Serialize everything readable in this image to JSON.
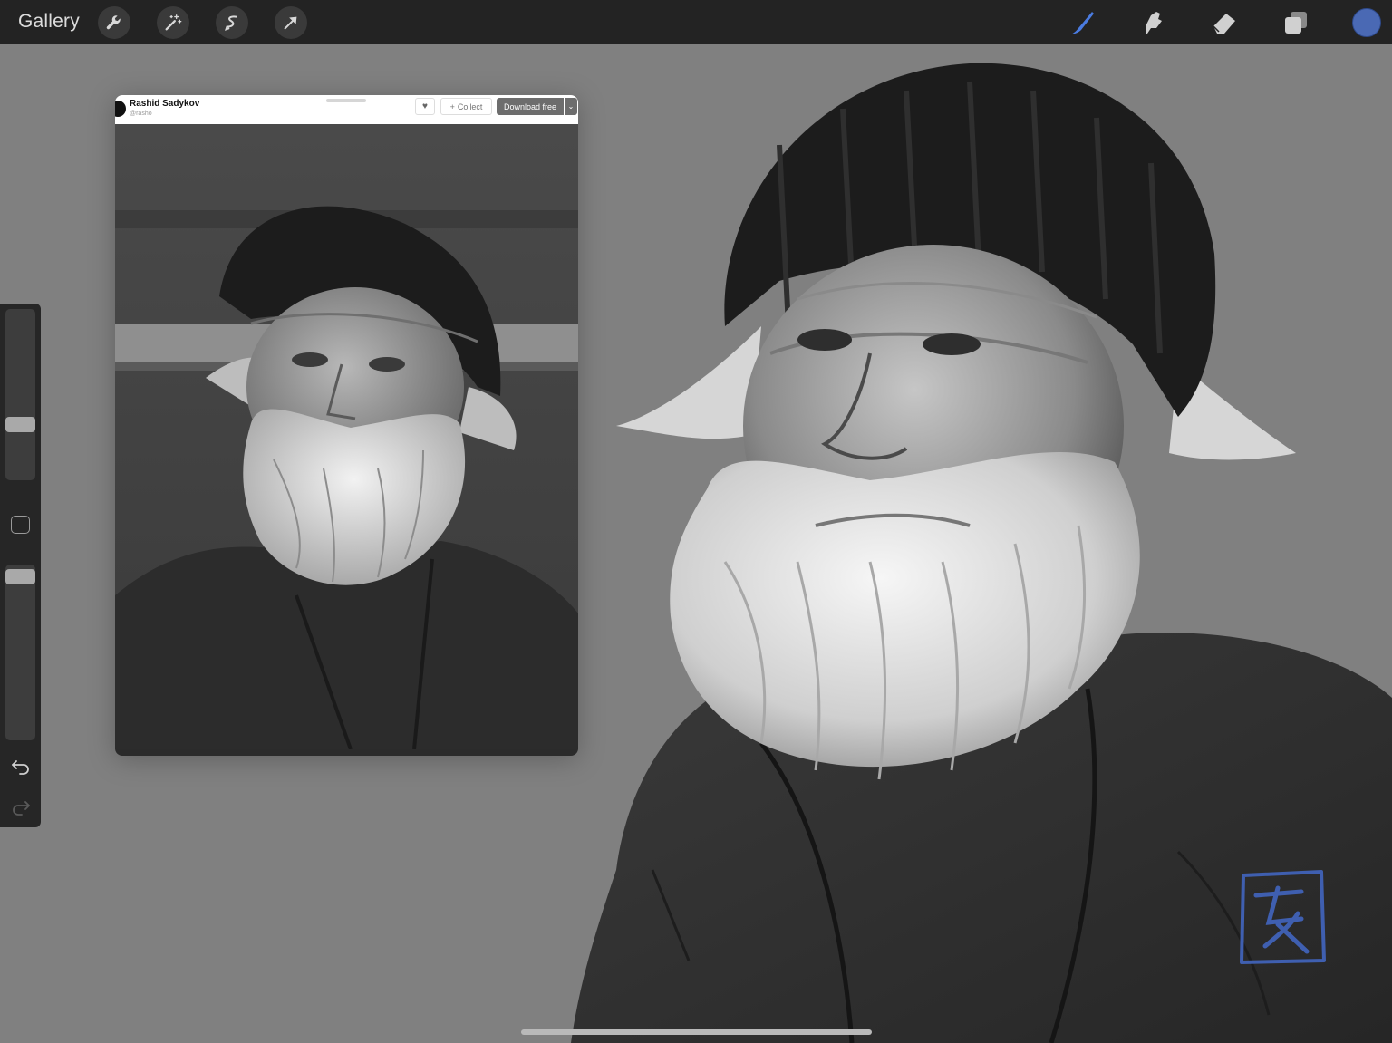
{
  "toolbar": {
    "gallery_label": "Gallery",
    "left_tools": [
      "actions-wrench-icon",
      "adjustments-wand-icon",
      "selection-icon",
      "transform-arrow-icon"
    ],
    "right_tools": [
      "brush-icon",
      "smudge-icon",
      "eraser-icon",
      "layers-icon"
    ],
    "active_tool": "brush",
    "current_color": "#4a69b4"
  },
  "sidebar": {
    "brush_size_level": 0.31,
    "opacity_level": 1.0,
    "undo_icon": "undo-icon",
    "redo_icon": "redo-icon"
  },
  "reference": {
    "author": "Rashid Sadykov",
    "handle": "@rasho",
    "collect_label": "Collect",
    "download_label": "Download free"
  },
  "colors": {
    "toolbar_bg": "#232323",
    "canvas_bg": "#808080",
    "accent_blue": "#4a69b4"
  }
}
